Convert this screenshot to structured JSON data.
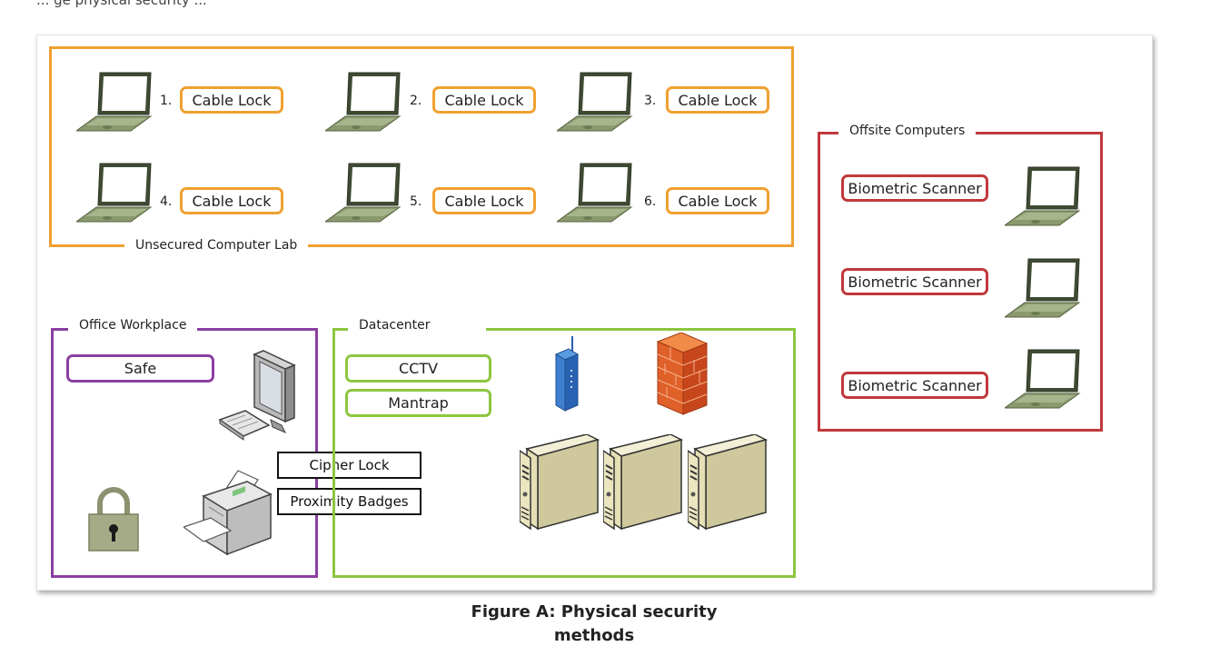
{
  "top_text": "... ge physical security ...",
  "groups": {
    "lab": {
      "label": "Unsecured Computer Lab",
      "color": "#f0a030"
    },
    "offsite": {
      "label": "Offsite Computers",
      "color": "#c0393b"
    },
    "office": {
      "label": "Office Workplace",
      "color": "#8a3fa0"
    },
    "datacenter": {
      "label": "Datacenter",
      "color": "#8cc63f"
    }
  },
  "lab_items": [
    {
      "num": "1.",
      "label": "Cable Lock"
    },
    {
      "num": "2.",
      "label": "Cable Lock"
    },
    {
      "num": "3.",
      "label": "Cable Lock"
    },
    {
      "num": "4.",
      "label": "Cable Lock"
    },
    {
      "num": "5.",
      "label": "Cable Lock"
    },
    {
      "num": "6.",
      "label": "Cable Lock"
    }
  ],
  "offsite_items": [
    {
      "label": "Biometric Scanner"
    },
    {
      "label": "Biometric Scanner"
    },
    {
      "label": "Biometric Scanner"
    }
  ],
  "office": {
    "safe": "Safe",
    "cipher_lock": "Cipher Lock",
    "proximity_badges": "Proximity Badges"
  },
  "datacenter": {
    "cctv": "CCTV",
    "mantrap": "Mantrap"
  },
  "caption": {
    "line1": "Figure A: Physical security",
    "line2": "methods"
  }
}
